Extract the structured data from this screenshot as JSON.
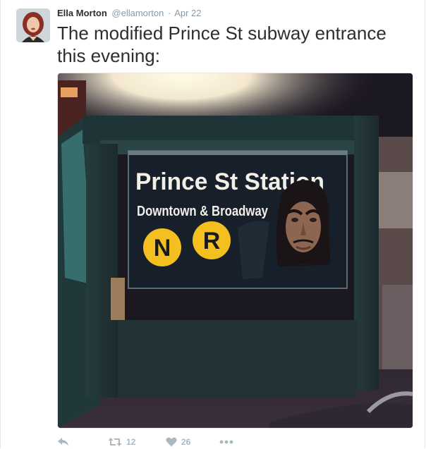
{
  "tweet": {
    "author": {
      "fullname": "Ella Morton",
      "username": "@ellamorton"
    },
    "separator": "·",
    "timestamp": "Apr 22",
    "text": "The modified Prince St subway entrance this evening:",
    "media": {
      "sign_line1": "Prince St Station",
      "sign_line2": "Downtown & Broadway",
      "lines": [
        "N",
        "R"
      ]
    },
    "actions": {
      "reply_icon": "reply-icon",
      "retweet_icon": "retweet-icon",
      "retweet_count": "12",
      "like_icon": "heart-icon",
      "like_count": "26",
      "more_icon": "more-icon"
    }
  }
}
